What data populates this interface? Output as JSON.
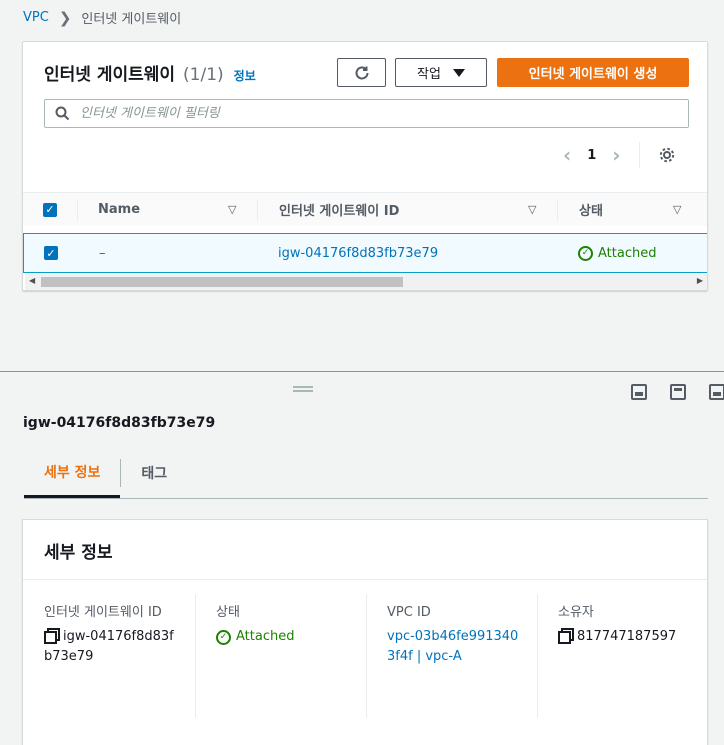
{
  "breadcrumb": {
    "root": "VPC",
    "current": "인터넷 게이트웨이"
  },
  "list": {
    "title": "인터넷 게이트웨이",
    "count": "(1/1)",
    "info_link": "정보",
    "actions_label": "작업",
    "create_label": "인터넷 게이트웨이 생성",
    "search_placeholder": "인터넷 게이트웨이 필터링",
    "page": "1",
    "columns": {
      "name": "Name",
      "id": "인터넷 게이트웨이 ID",
      "state": "상태"
    },
    "rows": [
      {
        "name": "–",
        "id": "igw-04176f8d83fb73e79",
        "state": "Attached"
      }
    ]
  },
  "detail": {
    "resource_id": "igw-04176f8d83fb73e79",
    "tabs": [
      "세부 정보",
      "태그"
    ],
    "section_title": "세부 정보",
    "fields": {
      "igw_label": "인터넷 게이트웨이 ID",
      "igw_value": "igw-04176f8d83fb73e79",
      "state_label": "상태",
      "state_value": "Attached",
      "vpc_label": "VPC ID",
      "vpc_value": "vpc-03b46fe9913403f4f | vpc-A",
      "owner_label": "소유자",
      "owner_value": "817747187597"
    }
  },
  "colors": {
    "primary": "#ec7211",
    "link": "#0073bb",
    "success": "#1d8102"
  },
  "icons": [
    "chevron-right-icon",
    "refresh-icon",
    "caret-down-icon",
    "search-icon",
    "gear-icon",
    "check-circle-icon",
    "copy-icon"
  ]
}
